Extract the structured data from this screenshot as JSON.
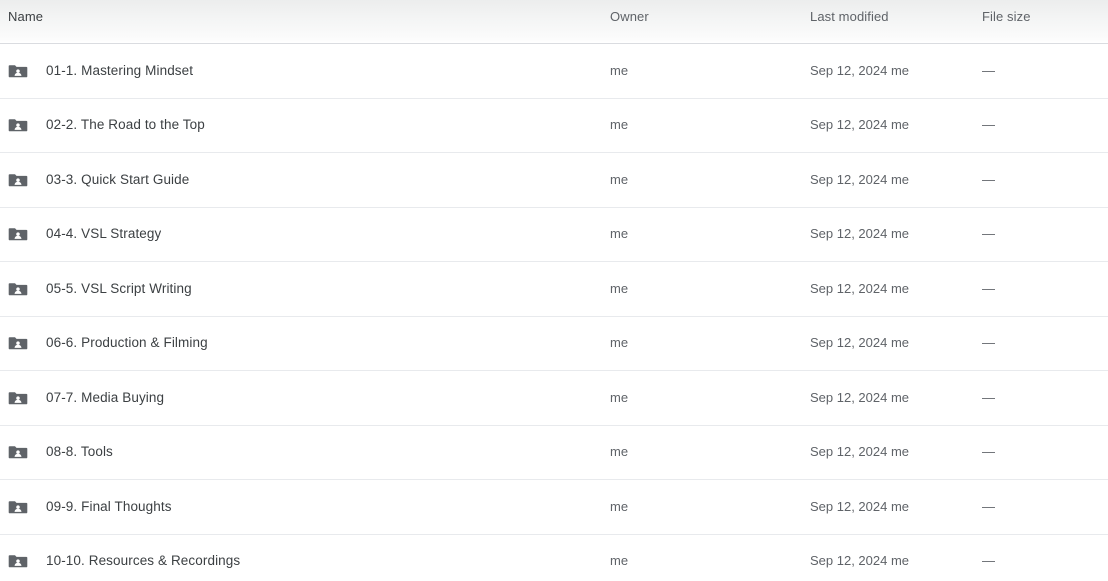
{
  "table": {
    "columns": [
      {
        "key": "name",
        "label": "Name"
      },
      {
        "key": "owner",
        "label": "Owner"
      },
      {
        "key": "modified",
        "label": "Last modified"
      },
      {
        "key": "size",
        "label": "File size"
      }
    ],
    "rows": [
      {
        "icon": "shared-folder-icon",
        "name": "01-1. Mastering Mindset",
        "owner": "me",
        "modified": "Sep 12, 2024 me",
        "size": "—"
      },
      {
        "icon": "shared-folder-icon",
        "name": "02-2. The Road to the Top",
        "owner": "me",
        "modified": "Sep 12, 2024 me",
        "size": "—"
      },
      {
        "icon": "shared-folder-icon",
        "name": "03-3. Quick Start Guide",
        "owner": "me",
        "modified": "Sep 12, 2024 me",
        "size": "—"
      },
      {
        "icon": "shared-folder-icon",
        "name": "04-4. VSL Strategy",
        "owner": "me",
        "modified": "Sep 12, 2024 me",
        "size": "—"
      },
      {
        "icon": "shared-folder-icon",
        "name": "05-5. VSL Script Writing",
        "owner": "me",
        "modified": "Sep 12, 2024 me",
        "size": "—"
      },
      {
        "icon": "shared-folder-icon",
        "name": "06-6. Production & Filming",
        "owner": "me",
        "modified": "Sep 12, 2024 me",
        "size": "—"
      },
      {
        "icon": "shared-folder-icon",
        "name": "07-7. Media Buying",
        "owner": "me",
        "modified": "Sep 12, 2024 me",
        "size": "—"
      },
      {
        "icon": "shared-folder-icon",
        "name": "08-8. Tools",
        "owner": "me",
        "modified": "Sep 12, 2024 me",
        "size": "—"
      },
      {
        "icon": "shared-folder-icon",
        "name": "09-9. Final Thoughts",
        "owner": "me",
        "modified": "Sep 12, 2024 me",
        "size": "—"
      },
      {
        "icon": "shared-folder-icon",
        "name": "10-10. Resources & Recordings",
        "owner": "me",
        "modified": "Sep 12, 2024 me",
        "size": "—"
      }
    ]
  },
  "colors": {
    "header_text": "#5f6368",
    "primary_text": "#3c4043",
    "secondary_text": "#5f6368",
    "divider": "#e8eaed",
    "header_border": "#dadce0",
    "folder_icon": "#5f6368",
    "background": "#ffffff"
  }
}
